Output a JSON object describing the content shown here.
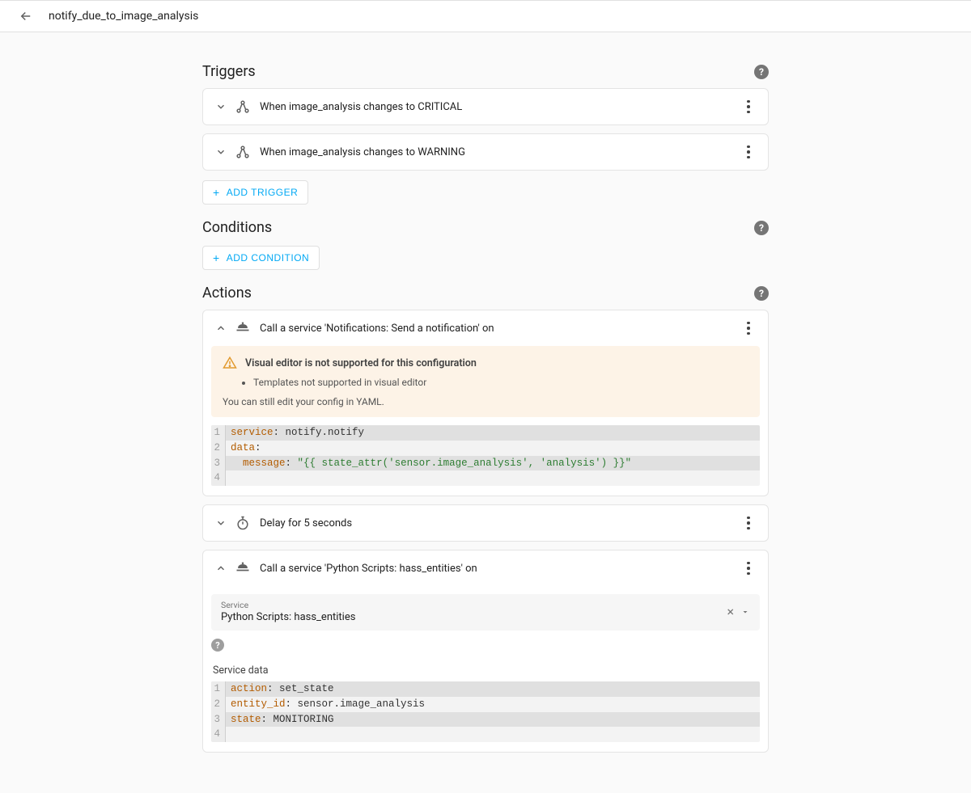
{
  "header": {
    "title": "notify_due_to_image_analysis"
  },
  "sections": {
    "triggers": {
      "title": "Triggers",
      "add_label": "ADD TRIGGER",
      "items": [
        {
          "label": "When image_analysis changes to CRITICAL"
        },
        {
          "label": "When image_analysis changes to WARNING"
        }
      ]
    },
    "conditions": {
      "title": "Conditions",
      "add_label": "ADD CONDITION"
    },
    "actions": {
      "title": "Actions",
      "action1": {
        "label": "Call a service 'Notifications: Send a notification' on",
        "warn_title": "Visual editor is not supported for this configuration",
        "warn_bullet": "Templates not supported in visual editor",
        "warn_foot": "You can still edit your config in YAML.",
        "yaml": {
          "l1_key": "service",
          "l1_val": "notify.notify",
          "l2_key": "data",
          "l3_key": "message",
          "l3_val": "\"{{ state_attr('sensor.image_analysis', 'analysis') }}\""
        }
      },
      "action2": {
        "label": "Delay for 5 seconds"
      },
      "action3": {
        "label": "Call a service 'Python Scripts: hass_entities' on",
        "service_label": "Service",
        "service_value": "Python Scripts: hass_entities",
        "service_data_label": "Service data",
        "yaml": {
          "l1_key": "action",
          "l1_val": "set_state",
          "l2_key": "entity_id",
          "l2_val": "sensor.image_analysis",
          "l3_key": "state",
          "l3_val": "MONITORING"
        }
      }
    }
  }
}
